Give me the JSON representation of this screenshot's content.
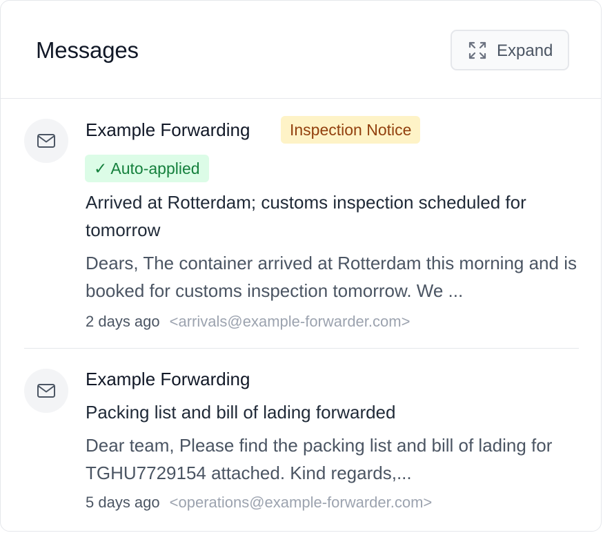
{
  "header": {
    "title": "Messages",
    "expand_label": "Expand",
    "expand_icon": "expand-icon"
  },
  "messages": [
    {
      "avatar_icon": "mail-icon",
      "sender": "Example Forwarding",
      "tags": [
        {
          "label": "Inspection Notice",
          "color": "#92400e",
          "background": "#fef3c7"
        },
        {
          "label": "✓ Auto-applied",
          "color": "#15803d",
          "background": "#dcfce7"
        }
      ],
      "subject": "Arrived at Rotterdam; customs inspection scheduled for tomorrow",
      "preview": "Dears, The container arrived at Rotterdam this morning and is booked for customs inspection tomorrow. We ...",
      "time": "2 days ago",
      "email": "<arrivals@example-forwarder.com>"
    },
    {
      "avatar_icon": "mail-icon",
      "sender": "Example Forwarding",
      "tags": [],
      "subject": "Packing list and bill of lading forwarded",
      "preview": "Dear team, Please find the packing list and bill of lading for TGHU7729154 attached. Kind regards,...",
      "time": "5 days ago",
      "email": "<operations@example-forwarder.com>"
    }
  ]
}
